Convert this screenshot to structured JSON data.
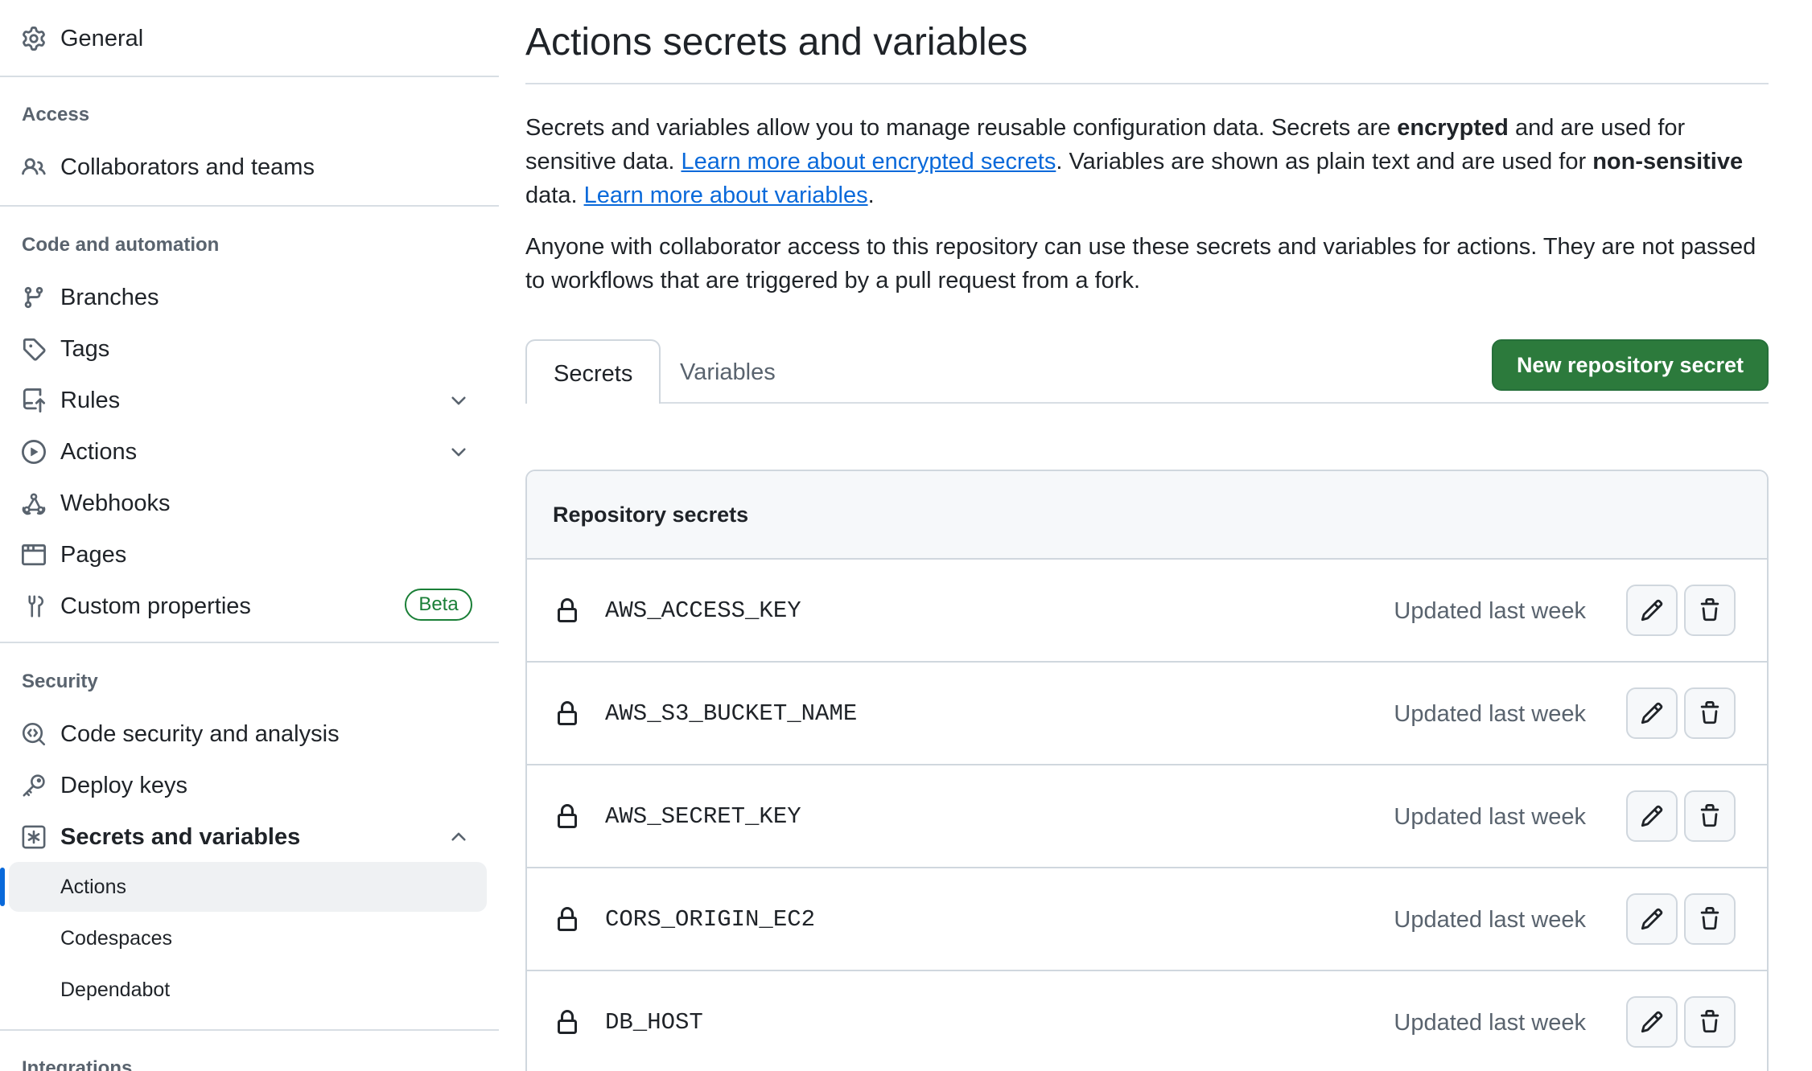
{
  "sidebar": {
    "general": {
      "label": "General",
      "icon": "gear-icon"
    },
    "access": {
      "heading": "Access",
      "items": [
        {
          "label": "Collaborators and teams",
          "icon": "people-icon"
        }
      ]
    },
    "code_and_automation": {
      "heading": "Code and automation",
      "items": [
        {
          "label": "Branches",
          "icon": "git-branch-icon"
        },
        {
          "label": "Tags",
          "icon": "tag-icon"
        },
        {
          "label": "Rules",
          "icon": "repo-push-icon",
          "expandable": true,
          "expanded": false
        },
        {
          "label": "Actions",
          "icon": "play-icon",
          "expandable": true,
          "expanded": false
        },
        {
          "label": "Webhooks",
          "icon": "webhook-icon"
        },
        {
          "label": "Pages",
          "icon": "browser-icon"
        },
        {
          "label": "Custom properties",
          "icon": "tools-icon",
          "badge": "Beta"
        }
      ]
    },
    "security": {
      "heading": "Security",
      "items": [
        {
          "label": "Code security and analysis",
          "icon": "codescan-icon"
        },
        {
          "label": "Deploy keys",
          "icon": "key-icon"
        },
        {
          "label": "Secrets and variables",
          "icon": "asterisk-icon",
          "expandable": true,
          "expanded": true,
          "selected": true
        }
      ],
      "sub_items": [
        {
          "label": "Actions",
          "active": true
        },
        {
          "label": "Codespaces",
          "active": false
        },
        {
          "label": "Dependabot",
          "active": false
        }
      ]
    },
    "integrations": {
      "heading": "Integrations"
    }
  },
  "main": {
    "title": "Actions secrets and variables",
    "intro": {
      "part1": "Secrets and variables allow you to manage reusable configuration data. Secrets are ",
      "bold1": "encrypted",
      "part2": " and are used for sensitive data. ",
      "link1": "Learn more about encrypted secrets",
      "part3": ". Variables are shown as plain text and are used for ",
      "bold2": "non-sensitive",
      "part4": " data. ",
      "link2": "Learn more about variables",
      "part5": "."
    },
    "collab_note": "Anyone with collaborator access to this repository can use these secrets and variables for actions. They are not passed to workflows that are triggered by a pull request from a fork.",
    "tabs": [
      {
        "label": "Secrets",
        "selected": true
      },
      {
        "label": "Variables",
        "selected": false
      }
    ],
    "new_secret_button": "New repository secret",
    "repository_secrets": {
      "heading": "Repository secrets",
      "rows": [
        {
          "name": "AWS_ACCESS_KEY",
          "updated": "Updated last week"
        },
        {
          "name": "AWS_S3_BUCKET_NAME",
          "updated": "Updated last week"
        },
        {
          "name": "AWS_SECRET_KEY",
          "updated": "Updated last week"
        },
        {
          "name": "CORS_ORIGIN_EC2",
          "updated": "Updated last week"
        },
        {
          "name": "DB_HOST",
          "updated": "Updated last week"
        }
      ]
    }
  },
  "colors": {
    "primary_button": "#2c7a3c",
    "link": "#0969da",
    "badge_green": "#1a7f37",
    "active_marker": "#0969da",
    "muted_text": "#59636e",
    "border": "#d0d7de"
  }
}
